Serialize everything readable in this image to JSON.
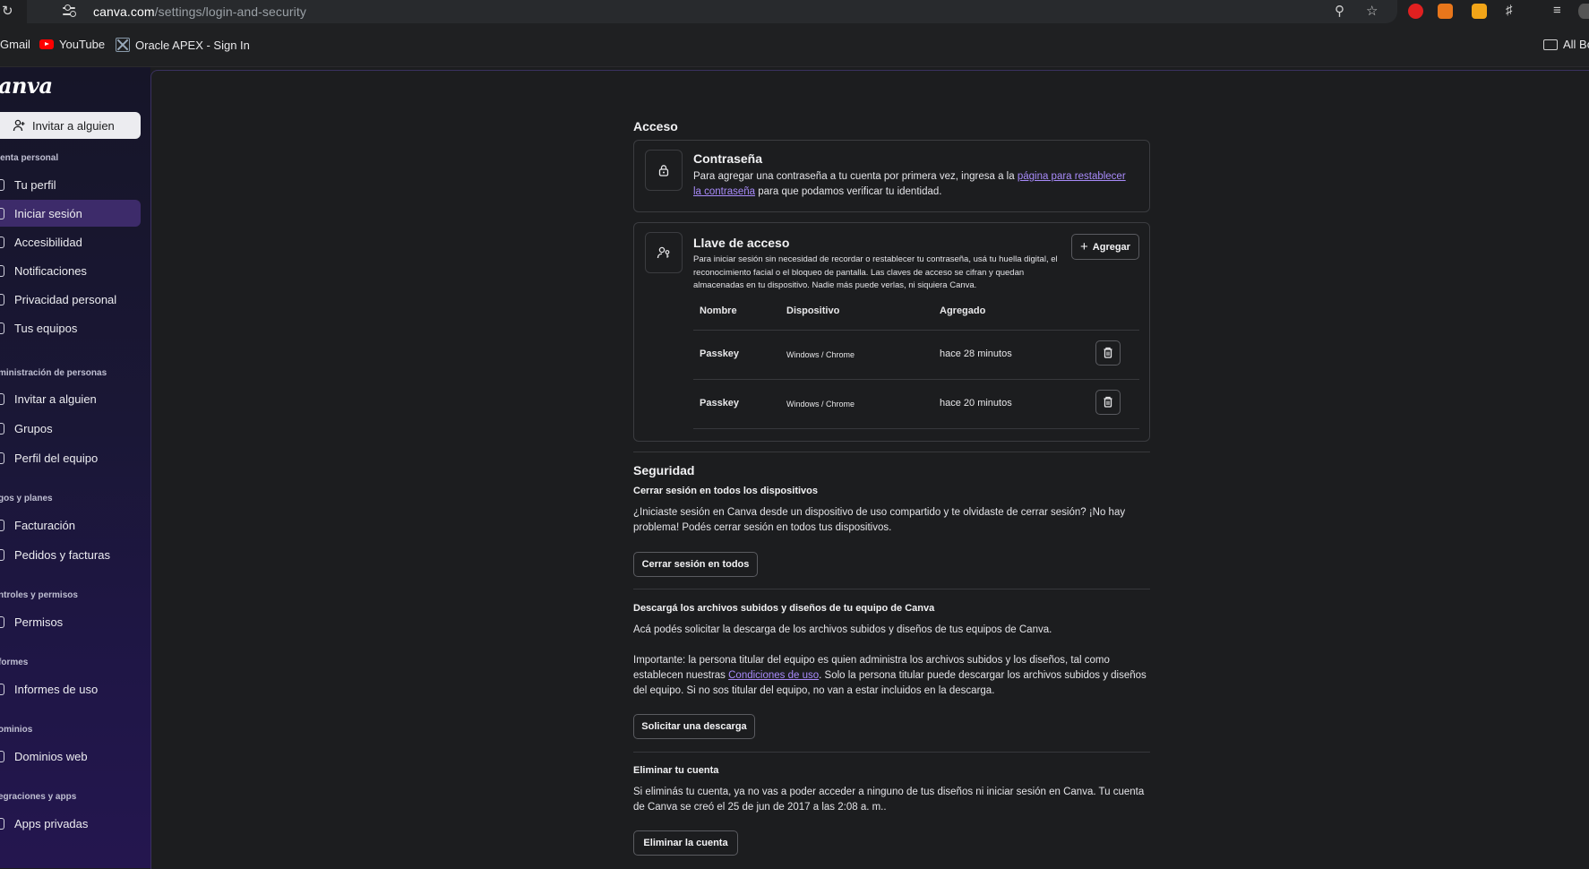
{
  "browser": {
    "url_host": "canva.com",
    "url_path": "/settings/login-and-security",
    "bookmarks": [
      "Gmail",
      "YouTube",
      "Oracle APEX - Sign In"
    ],
    "all_bookmarks": "All Bo"
  },
  "sidebar": {
    "logo": "Canva",
    "invite_button": "Invitar a alguien",
    "sections": [
      {
        "title": "Cuenta personal",
        "items": [
          "Tu perfil",
          "Iniciar sesión",
          "Accesibilidad",
          "Notificaciones",
          "Privacidad personal",
          "Tus equipos"
        ]
      },
      {
        "title": "Administración de personas",
        "items": [
          "Invitar a alguien",
          "Grupos",
          "Perfil del equipo"
        ]
      },
      {
        "title": "Pagos y planes",
        "items": [
          "Facturación",
          "Pedidos y facturas"
        ]
      },
      {
        "title": "Controles y permisos",
        "items": [
          "Permisos"
        ]
      },
      {
        "title": "Informes",
        "items": [
          "Informes de uso"
        ]
      },
      {
        "title": "Dominios",
        "items": [
          "Dominios web"
        ]
      },
      {
        "title": "Integraciones y apps",
        "items": [
          "Apps privadas"
        ]
      }
    ],
    "active_item": "Iniciar sesión"
  },
  "access": {
    "heading": "Acceso",
    "password": {
      "title": "Contraseña",
      "text_before": "Para agregar una contraseña a tu cuenta por primera vez, ingresa a la ",
      "link": "página para restablecer la contraseña",
      "text_after": " para que podamos verificar tu identidad."
    },
    "passkey": {
      "title": "Llave de acceso",
      "add_button": "Agregar",
      "description": "Para iniciar sesión sin necesidad de recordar o restablecer tu contraseña, usá tu huella digital, el reconocimiento facial o el bloqueo de pantalla. Las claves de acceso se cifran y quedan almacenadas en tu dispositivo. Nadie más puede verlas, ni siquiera Canva.",
      "columns": [
        "Nombre",
        "Dispositivo",
        "Agregado"
      ],
      "rows": [
        {
          "name": "Passkey",
          "device": "Windows / Chrome",
          "added": "hace 28 minutos"
        },
        {
          "name": "Passkey",
          "device": "Windows / Chrome",
          "added": "hace 20 minutos"
        }
      ]
    }
  },
  "security": {
    "heading": "Seguridad",
    "logout_all": {
      "title": "Cerrar sesión en todos los dispositivos",
      "text": "¿Iniciaste sesión en Canva desde un dispositivo de uso compartido y te olvidaste de cerrar sesión? ¡No hay problema! Podés cerrar sesión en todos tus dispositivos.",
      "button": "Cerrar sesión en todos"
    },
    "download": {
      "title": "Descargá los archivos subidos y diseños de tu equipo de Canva",
      "text": "Acá podés solicitar la descarga de los archivos subidos y diseños de tus equipos de Canva.",
      "important_before": "Importante: la persona titular del equipo es quien administra los archivos subidos y los diseños, tal como establecen nuestras ",
      "important_link": "Condiciones de uso",
      "important_after": ". Solo la persona titular puede descargar los archivos subidos y diseños del equipo. Si no sos titular del equipo, no van a estar incluidos en la descarga.",
      "button": "Solicitar una descarga"
    },
    "delete": {
      "title": "Eliminar tu cuenta",
      "text": "Si eliminás tu cuenta, ya no vas a poder acceder a ninguno de tus diseños ni iniciar sesión en Canva. Tu cuenta de Canva se creó el 25 de jun de 2017 a las 2:08 a. m..",
      "button": "Eliminar la cuenta"
    }
  }
}
